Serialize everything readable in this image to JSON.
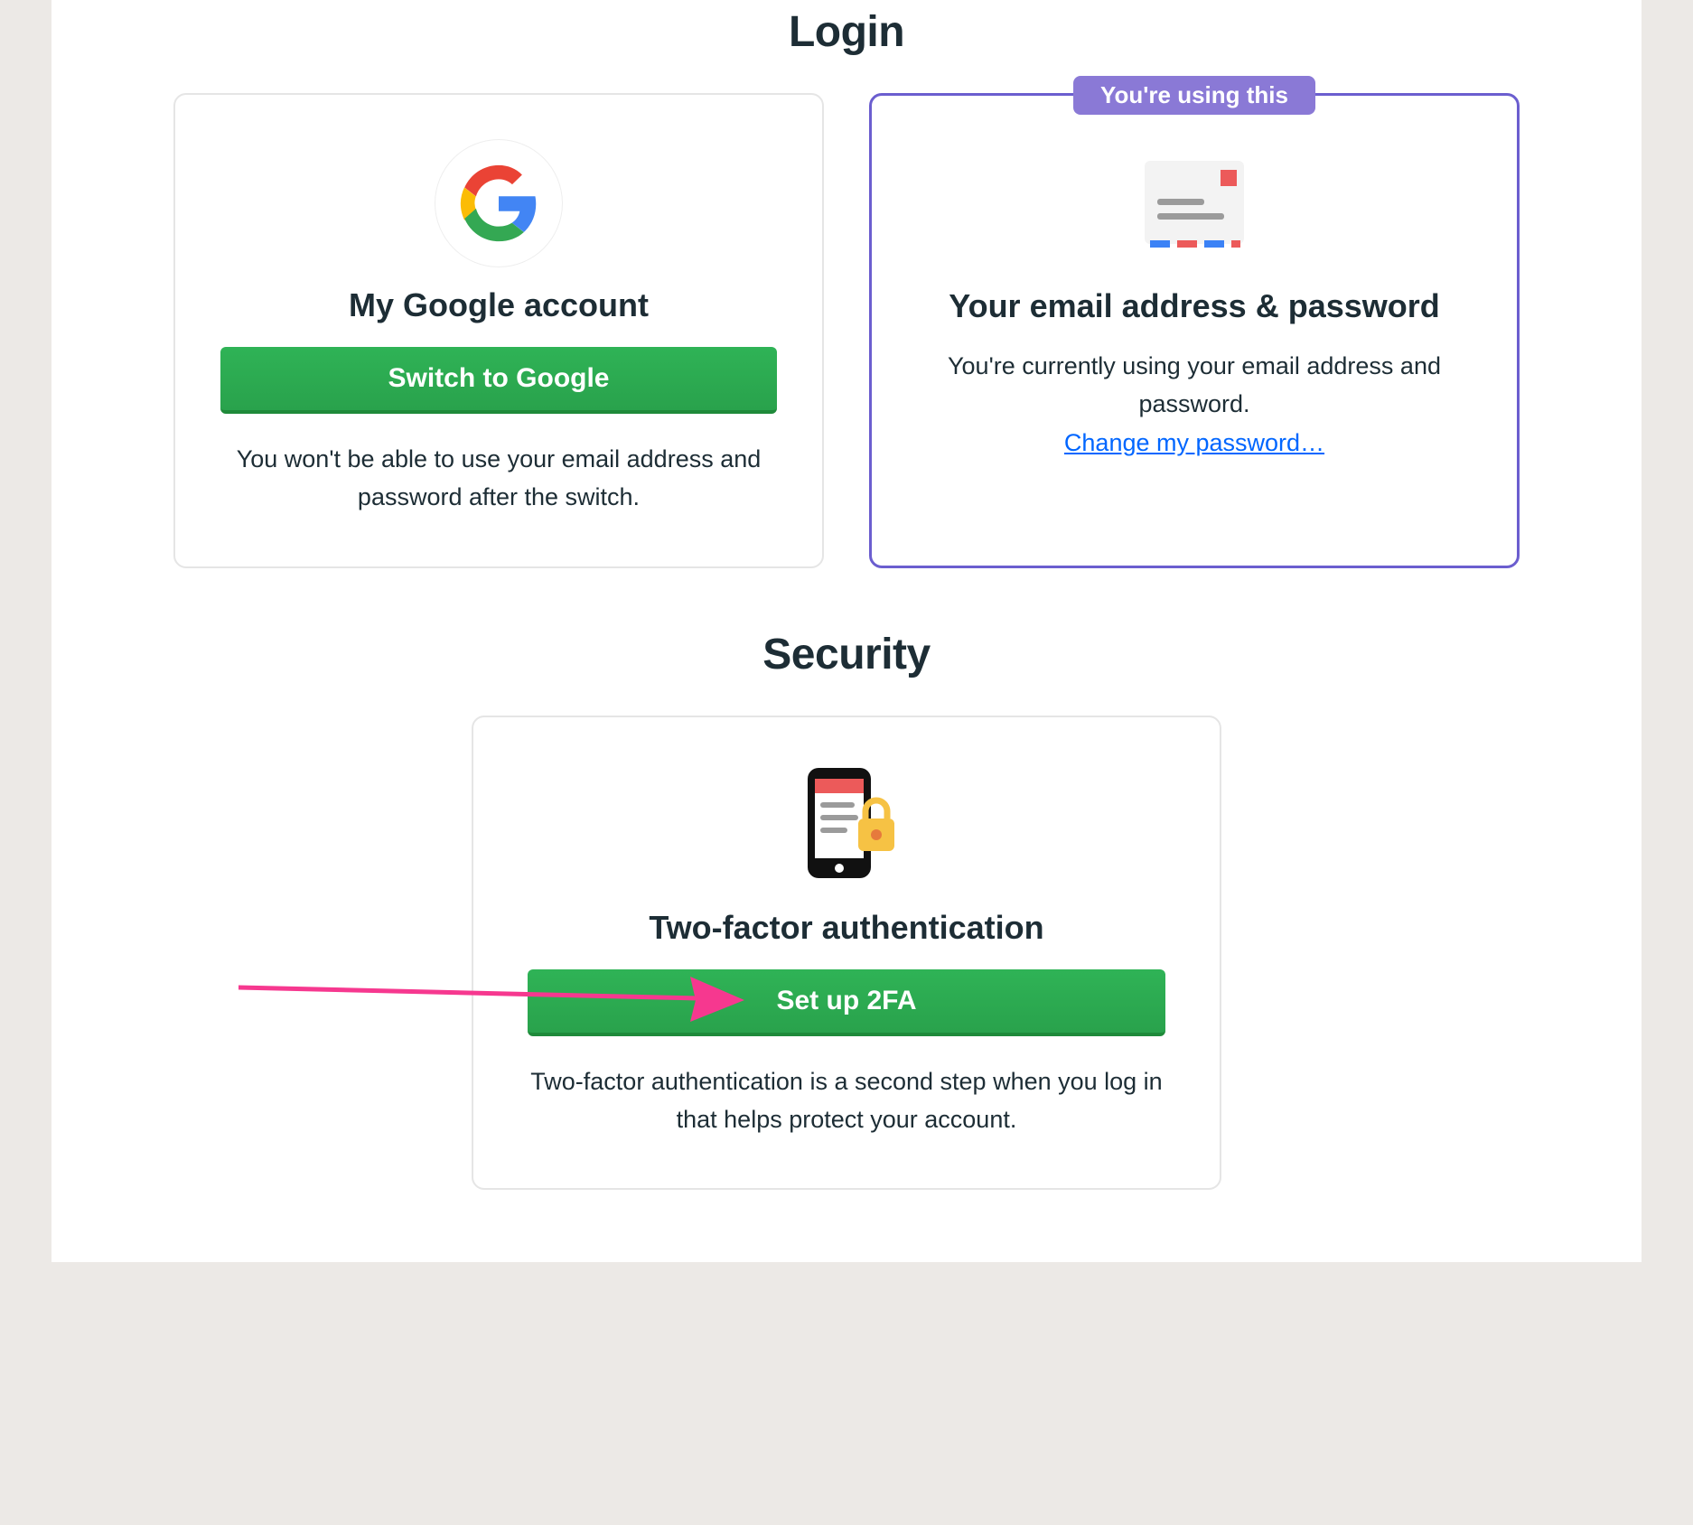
{
  "login": {
    "heading": "Login",
    "google_card": {
      "title": "My Google account",
      "button": "Switch to Google",
      "description": "You won't be able to use your email address and password after the switch."
    },
    "email_card": {
      "badge": "You're using this",
      "title": "Your email address & password",
      "description": "You're currently using your email address and password.",
      "change_link": "Change my password…"
    }
  },
  "security": {
    "heading": "Security",
    "tfa_card": {
      "title": "Two-factor authentication",
      "button": "Set up 2FA",
      "description": "Two-factor authentication is a second step when you log in that helps protect your account."
    }
  },
  "colors": {
    "accent_purple": "#6b5ecf",
    "button_green": "#2fa850",
    "link_blue": "#0066ff",
    "annotation_pink": "#f6388f"
  }
}
